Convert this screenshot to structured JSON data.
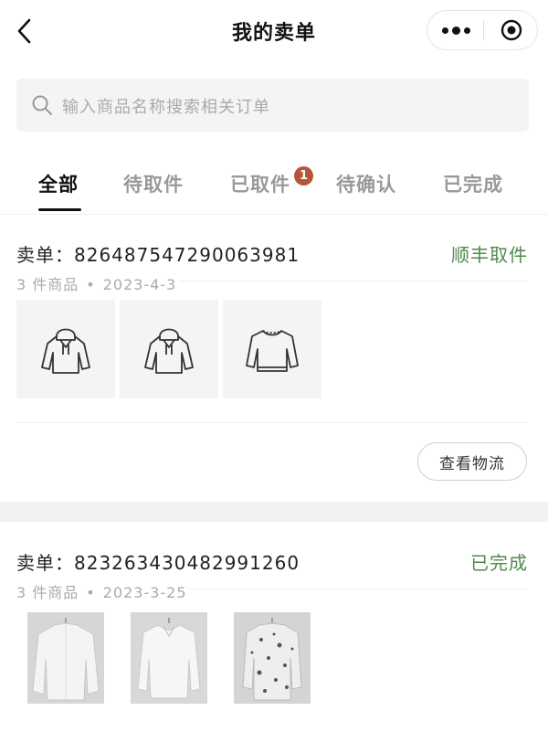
{
  "header": {
    "title": "我的卖单"
  },
  "search": {
    "placeholder": "输入商品名称搜索相关订单"
  },
  "tabs": [
    {
      "label": "全部",
      "active": true
    },
    {
      "label": "待取件",
      "active": false
    },
    {
      "label": "已取件",
      "active": false,
      "badge": "1"
    },
    {
      "label": "待确认",
      "active": false
    },
    {
      "label": "已完成",
      "active": false
    }
  ],
  "orders": [
    {
      "label": "卖单：",
      "number": "826487547290063981",
      "status": "顺丰取件",
      "count": "3 件商品",
      "dot": "•",
      "date": "2023-4-3",
      "items": [
        "hoodie-icon",
        "hoodie-icon",
        "sweater-icon"
      ],
      "button": "查看物流"
    },
    {
      "label": "卖单：",
      "number": "823263430482991260",
      "status": "已完成",
      "count": "3 件商品",
      "dot": "•",
      "date": "2023-3-25",
      "items": [
        "white-jacket-photo",
        "white-blouse-photo",
        "printed-shirt-photo"
      ]
    }
  ],
  "colors": {
    "status_green": "#4e8a4a",
    "badge_red": "#b7553a",
    "background_gray": "#f4f4f4"
  }
}
